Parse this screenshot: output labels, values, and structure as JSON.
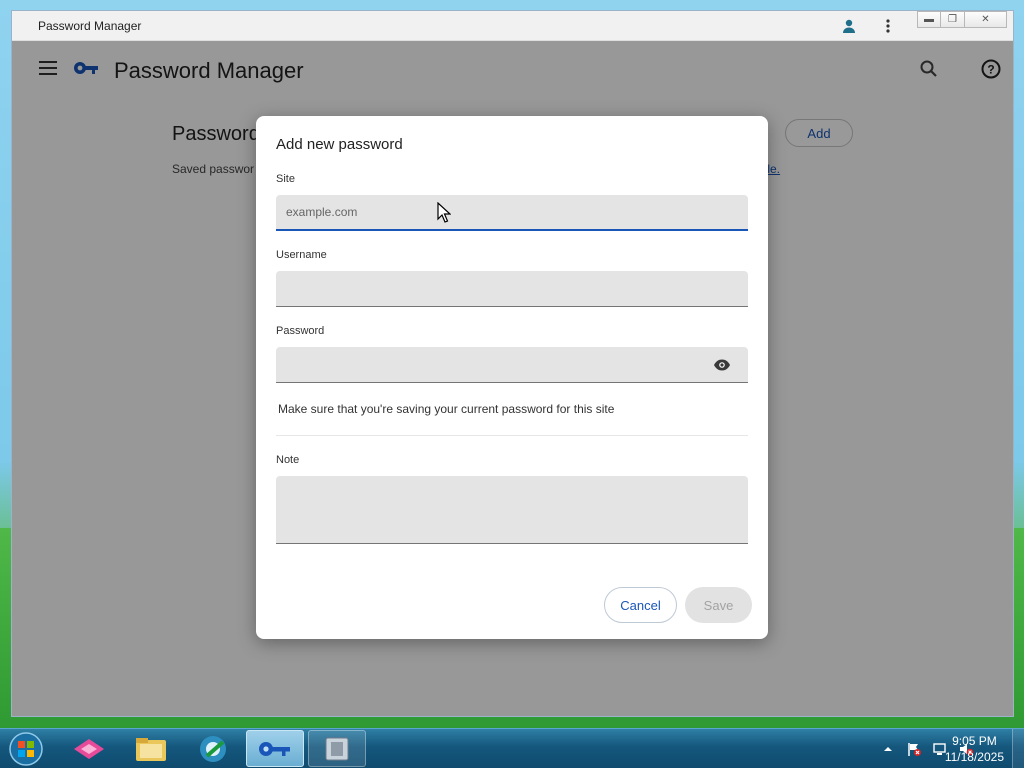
{
  "window": {
    "title": "Password Manager",
    "controls": [
      "minimize",
      "restore",
      "close"
    ]
  },
  "app": {
    "title": "Password Manager",
    "section_title": "Passwords",
    "section_desc": "Saved passwor",
    "section_link": "y file.",
    "add_label": "Add",
    "icons": [
      "menu-icon",
      "key-logo-icon",
      "search-icon",
      "help-icon",
      "person-icon",
      "more-vert-icon"
    ]
  },
  "dialog": {
    "title": "Add new password",
    "site": {
      "label": "Site",
      "placeholder": "example.com",
      "value": ""
    },
    "username": {
      "label": "Username",
      "value": ""
    },
    "password": {
      "label": "Password",
      "value": ""
    },
    "hint": "Make sure that you're saving your current password for this site",
    "note": {
      "label": "Note",
      "value": ""
    },
    "cancel_label": "Cancel",
    "save_label": "Save"
  },
  "taskbar": {
    "apps": [
      "start-orb",
      "app-launcher-icon",
      "file-explorer-icon",
      "media-player-icon",
      "password-manager-icon",
      "system-utility-icon"
    ],
    "clock_time": "9:05 PM",
    "clock_date": "11/18/2025"
  },
  "colors": {
    "accent": "#1a56b8",
    "scrim": "rgba(0,0,0,0.40)",
    "taskbar": "#15577d"
  }
}
